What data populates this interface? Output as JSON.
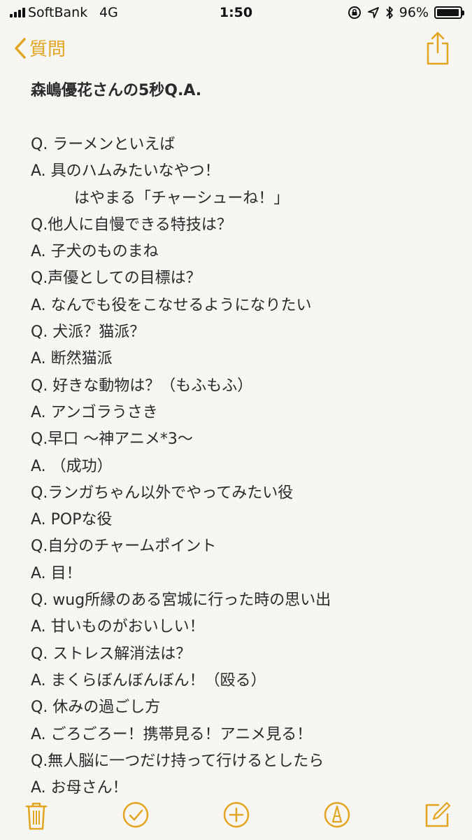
{
  "status_bar": {
    "carrier": "SoftBank",
    "network": "4G",
    "time": "1:50",
    "battery_percent": "96%",
    "battery_level": 0.96
  },
  "nav": {
    "back_label": "質問"
  },
  "note": {
    "title": "森嶋優花さんの5秒Q.A.",
    "lines": [
      {
        "text": "Q. ラーメンといえば"
      },
      {
        "text": "A. 具のハムみたいなやつ！"
      },
      {
        "text": "はやまる「チャーシューね！」"
      },
      {
        "text": "Q.他人に自慢できる特技は？"
      },
      {
        "text": "A. 子犬のものまね"
      },
      {
        "text": "Q.声優としての目標は？"
      },
      {
        "text": "A. なんでも役をこなせるようになりたい"
      },
      {
        "text": "Q. 犬派？猫派？"
      },
      {
        "text": "A. 断然猫派"
      },
      {
        "text": "Q. 好きな動物は？（もふもふ）"
      },
      {
        "text": "A. アンゴラうさき"
      },
      {
        "text": "Q.早口  〜神アニメ*3〜"
      },
      {
        "text": "A.  （成功）"
      },
      {
        "text": "Q.ランガちゃん以外でやってみたい役"
      },
      {
        "text": "A. POPな役"
      },
      {
        "text": "Q.自分のチャームポイント"
      },
      {
        "text": "A.  目！"
      },
      {
        "text": "Q. wug所縁のある宮城に行った時の思い出"
      },
      {
        "text": "A. 甘いものがおいしい！"
      },
      {
        "text": "Q. ストレス解消法は？"
      },
      {
        "text": "A. まくらぼんぼんぼん！（殴る）"
      },
      {
        "text": "Q. 休みの過ごし方"
      },
      {
        "text": "A.  ごろごろー！携帯見る！アニメ見る！"
      },
      {
        "text": "Q.無人脳に一つだけ持って行けるとしたら"
      },
      {
        "text": "A. お母さん！"
      }
    ]
  },
  "colors": {
    "accent": "#e2a521",
    "text": "#2a2a2a",
    "background": "#f8f7f4"
  },
  "toolbar": {
    "icons": [
      "trash-icon",
      "checklist-icon",
      "add-icon",
      "markup-icon",
      "compose-icon"
    ]
  }
}
